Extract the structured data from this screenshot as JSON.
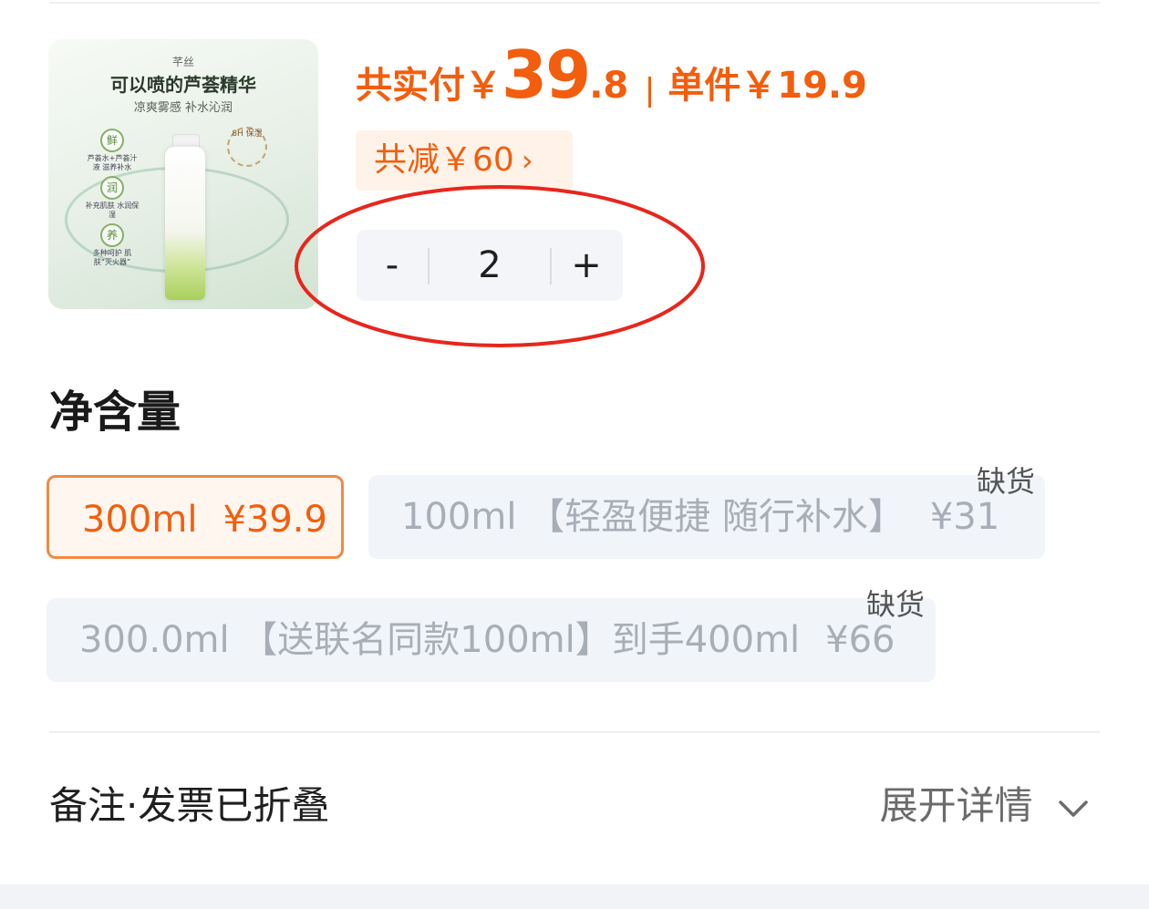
{
  "product": {
    "image_brand": "芊丝",
    "image_title": "可以喷的芦荟精华",
    "image_subtitle": "凉爽雾感 补水沁润",
    "image_features": [
      {
        "icon": "鲜",
        "caption": "芦荟水+芦荟汁液 滋养补水"
      },
      {
        "icon": "润",
        "caption": "补充肌肤 水润保湿"
      },
      {
        "icon": "养",
        "caption": "多种呵护 肌肤“灭火器”"
      }
    ],
    "image_seal": "8H 保湿"
  },
  "price": {
    "total_label": "共实付￥",
    "total_int": "39",
    "total_dec": ".8",
    "unit_label": "单件￥19.9",
    "accent_color": "#f25e0d"
  },
  "discount": {
    "label": "共减￥60",
    "chevron": "›"
  },
  "stepper": {
    "minus": "-",
    "quantity": "2",
    "plus": "+"
  },
  "spec": {
    "title": "净含量",
    "options": [
      {
        "label": "300ml",
        "price": "¥39.9",
        "state": "selected"
      },
      {
        "label": "100ml 【轻盈便捷 随行补水】",
        "price": "¥31",
        "state": "disabled",
        "badge": "缺货"
      },
      {
        "label": "300.0ml 【送联名同款100ml】到手400ml",
        "price": "¥66",
        "state": "disabled",
        "badge": "缺货"
      }
    ]
  },
  "remarks": {
    "left": "备注·发票已折叠",
    "right": "展开详情",
    "icon": "chevron-down-icon"
  }
}
